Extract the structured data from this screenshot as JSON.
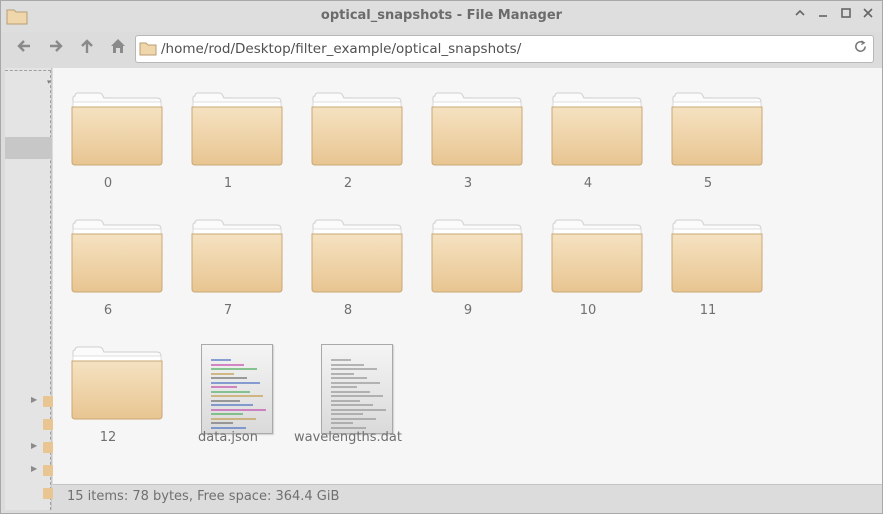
{
  "window": {
    "title": "optical_snapshots - File Manager"
  },
  "toolbar": {
    "back_icon": "back-arrow-icon",
    "forward_icon": "forward-arrow-icon",
    "up_icon": "up-arrow-icon",
    "home_icon": "home-icon",
    "path": "/home/rod/Desktop/filter_example/optical_snapshots/",
    "reload_icon": "reload-icon"
  },
  "items": [
    {
      "name": "0",
      "type": "folder"
    },
    {
      "name": "1",
      "type": "folder"
    },
    {
      "name": "2",
      "type": "folder"
    },
    {
      "name": "3",
      "type": "folder"
    },
    {
      "name": "4",
      "type": "folder"
    },
    {
      "name": "5",
      "type": "folder"
    },
    {
      "name": "6",
      "type": "folder"
    },
    {
      "name": "7",
      "type": "folder"
    },
    {
      "name": "8",
      "type": "folder"
    },
    {
      "name": "9",
      "type": "folder"
    },
    {
      "name": "10",
      "type": "folder"
    },
    {
      "name": "11",
      "type": "folder"
    },
    {
      "name": "12",
      "type": "folder"
    },
    {
      "name": "data.json",
      "type": "file-json"
    },
    {
      "name": "wavelengths.dat",
      "type": "file-text"
    }
  ],
  "status": {
    "text": "15 items: 78 bytes, Free space: 364.4 GiB"
  },
  "colors": {
    "folder_top": "#f5e2c1",
    "folder_bottom": "#e8c591",
    "content_bg": "#f6f6f6"
  }
}
